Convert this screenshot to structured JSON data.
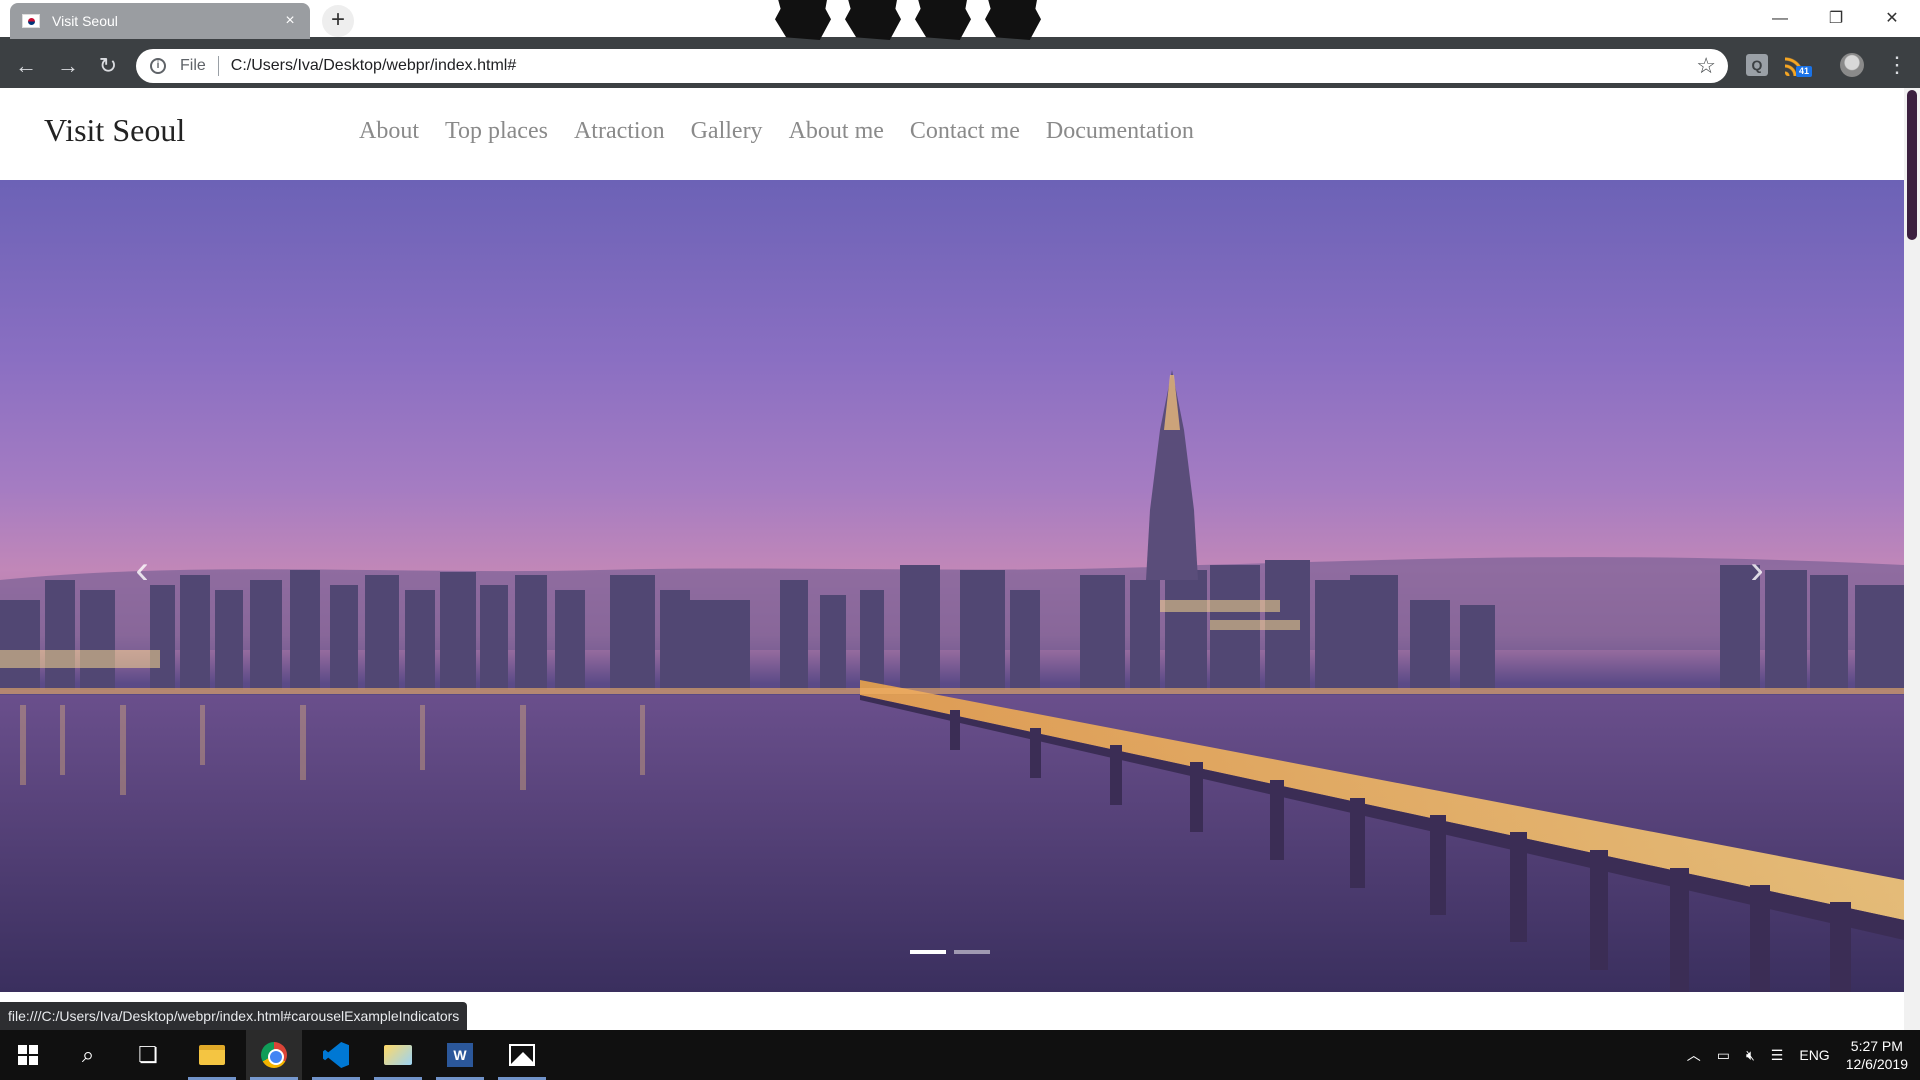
{
  "browser": {
    "tab_title": "Visit Seoul",
    "tab_close": "×",
    "new_tab": "+",
    "url_scheme": "File",
    "url": "C:/Users/Iva/Desktop/webpr/index.html#",
    "star": "☆",
    "ext_badge": "41",
    "window_minimize": "—",
    "window_restore": "❐",
    "window_close": "✕"
  },
  "site": {
    "brand": "Visit Seoul",
    "nav": [
      "About",
      "Top places",
      "Atraction",
      "Gallery",
      "About me",
      "Contact me",
      "Documentation"
    ]
  },
  "carousel": {
    "prev": "‹",
    "next": "›",
    "slide_count": 2,
    "active_index": 0
  },
  "status_bar": {
    "url": "file:///C:/Users/Iva/Desktop/webpr/index.html#carouselExampleIndicators"
  },
  "taskbar": {
    "language": "ENG",
    "time": "5:27 PM",
    "date": "12/6/2019",
    "apps": [
      "file-explorer",
      "chrome",
      "vscode",
      "folder",
      "word",
      "photos"
    ]
  },
  "colors": {
    "browser_chrome": "#3c4043",
    "nav_link": "#8a8a8a",
    "hero_sky_top": "#6c62b6",
    "hero_sky_bottom": "#c187b8"
  }
}
